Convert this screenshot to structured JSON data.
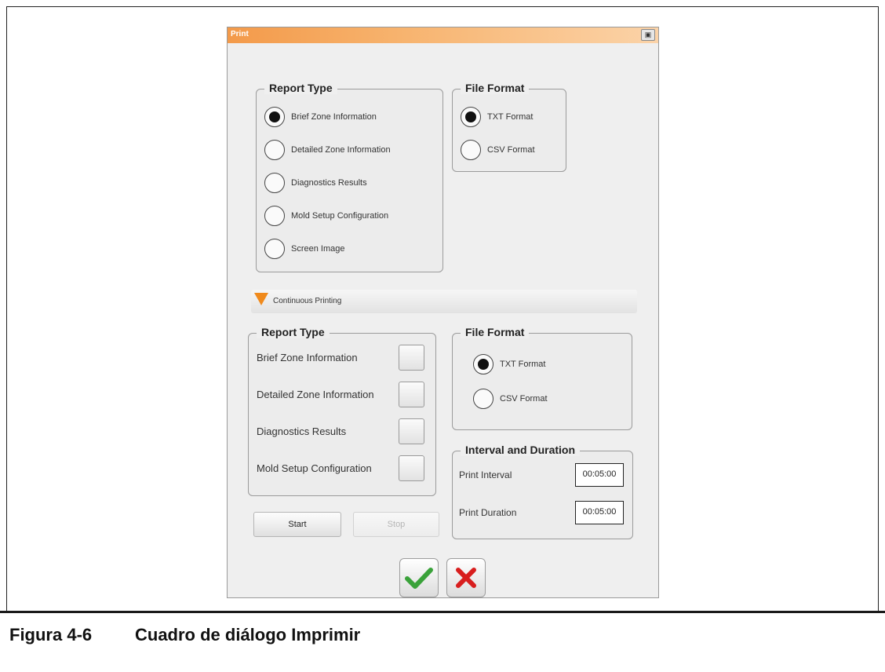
{
  "dialog": {
    "title": "Print",
    "report_type": {
      "legend": "Report Type",
      "options": [
        {
          "label": "Brief Zone Information",
          "selected": true
        },
        {
          "label": "Detailed Zone Information",
          "selected": false
        },
        {
          "label": "Diagnostics Results",
          "selected": false
        },
        {
          "label": "Mold Setup Configuration",
          "selected": false
        },
        {
          "label": "Screen Image",
          "selected": false
        }
      ]
    },
    "file_format": {
      "legend": "File Format",
      "options": [
        {
          "label": "TXT Format",
          "selected": true
        },
        {
          "label": "CSV Format",
          "selected": false
        }
      ]
    },
    "continuous": {
      "label": "Continuous Printing",
      "report_type": {
        "legend": "Report Type",
        "items": [
          {
            "label": "Brief Zone Information",
            "checked": false
          },
          {
            "label": "Detailed Zone Information",
            "checked": false
          },
          {
            "label": "Diagnostics Results",
            "checked": false
          },
          {
            "label": "Mold Setup Configuration",
            "checked": false
          }
        ]
      },
      "file_format": {
        "legend": "File Format",
        "options": [
          {
            "label": "TXT Format",
            "selected": true
          },
          {
            "label": "CSV Format",
            "selected": false
          }
        ]
      },
      "interval": {
        "legend": "Interval and Duration",
        "print_interval_label": "Print Interval",
        "print_interval_value": "00:05:00",
        "print_duration_label": "Print Duration",
        "print_duration_value": "00:05:00"
      },
      "start_label": "Start",
      "stop_label": "Stop"
    },
    "colors": {
      "accent": "#f08a1c",
      "ok": "#3aa23a",
      "cancel": "#d81e1e"
    }
  },
  "caption": {
    "number": "Figura 4-6",
    "text": "Cuadro de diálogo Imprimir"
  }
}
